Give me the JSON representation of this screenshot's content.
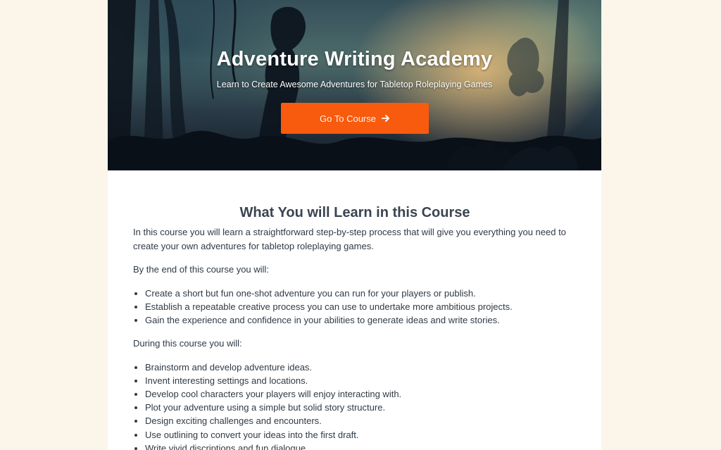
{
  "hero": {
    "title": "Adventure Writing Academy",
    "subtitle": "Learn to Create Awesome Adventures for Tabletop Roleplaying Games",
    "cta_label": "Go To Course",
    "cta_icon": "arrow-right-icon",
    "cta_color": "#f85a0e"
  },
  "main": {
    "heading": "What You will Learn in this Course",
    "intro": "In this course you will learn a straightforward step-by-step process that will give you everything you need to create your own adventures for tabletop roleplaying games.",
    "end_label": "By the end of this course you will:",
    "end_items": [
      "Create a short but fun one-shot adventure you can run for your players or publish.",
      "Establish a repeatable creative process you can use to undertake more ambitious projects.",
      "Gain the experience and confidence in your abilities to generate ideas and write stories."
    ],
    "during_label": "During this course you will:",
    "during_items": [
      "Brainstorm and develop adventure ideas.",
      "Invent interesting settings and locations.",
      "Develop cool characters your players will enjoy interacting with.",
      "Plot your adventure using a simple but solid story structure.",
      "Design exciting challenges and encounters.",
      "Use outlining to convert your ideas into the first draft.",
      "Write vivid discriptions and fun dialogue."
    ]
  },
  "colors": {
    "page_background": "#fbf5ea",
    "content_background": "#ffffff",
    "text": "#2f3a45",
    "heading": "#3a4452"
  }
}
